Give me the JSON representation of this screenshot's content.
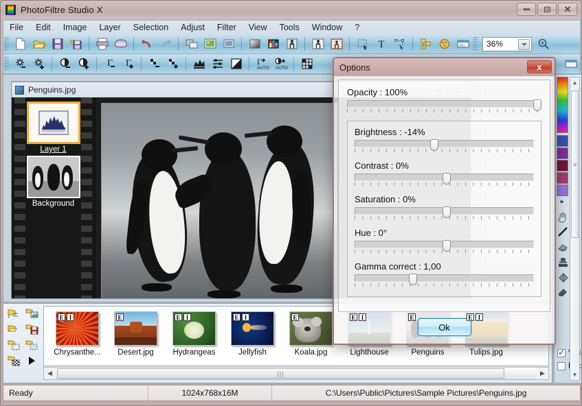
{
  "window": {
    "title": "PhotoFiltre Studio X",
    "icon": "app-logo-icon",
    "controls": {
      "minimize": "minimize",
      "maximize": "maximize",
      "close": "close"
    }
  },
  "menubar": {
    "items": [
      "File",
      "Edit",
      "Image",
      "Layer",
      "Selection",
      "Adjust",
      "Filter",
      "View",
      "Tools",
      "Window",
      "?"
    ]
  },
  "toolbar_main": {
    "zoom_value": "36%",
    "buttons": [
      "new-document-icon",
      "open-folder-icon",
      "save-icon",
      "save-as-icon",
      "print-icon",
      "print-preview-icon",
      "undo-icon",
      "redo-icon",
      "copy-images-icon",
      "paste-image-icon",
      "duplicate-image-icon",
      "gradient-icon",
      "color-palette-icon",
      "transform-icon",
      "effect-icon",
      "framed-effect-icon",
      "selection-icon",
      "text-tool-icon",
      "path-tool-icon",
      "layer-manager-icon",
      "color-wheel-icon",
      "module-icon"
    ],
    "zoom_dropdown": "chevron-down-icon",
    "zoom_in": "magnifier-plus-icon"
  },
  "toolbar_adjust": {
    "buttons": [
      "brightness-decrease-icon",
      "brightness-increase-icon",
      "contrast-decrease-icon",
      "contrast-increase-icon",
      "gamma-decrease-icon",
      "gamma-increase-icon",
      "dither-decrease-icon",
      "dither-increase-icon",
      "histogram-icon",
      "levels-icon",
      "negative-icon",
      "auto-gamma-icon",
      "auto-contrast-icon",
      "grid-icon"
    ],
    "glyphs": [
      "Γ−",
      "Γ+",
      "AUTO"
    ]
  },
  "document": {
    "title": "Penguins.jpg",
    "icon": "image-document-icon",
    "controls": {
      "minimize": "minimize",
      "maximize": "maximize"
    },
    "image_alt": "three-penguins-grayscale-photo"
  },
  "layers": {
    "items": [
      {
        "name": "Layer 1",
        "selected": true,
        "thumb": "histogram-adjustment-layer-icon"
      },
      {
        "name": "Background",
        "selected": false,
        "thumb": "penguins-thumbnail"
      }
    ]
  },
  "layer_props": {
    "visible_label": "Visible",
    "visible_checked": true,
    "locked_label": "Locked",
    "locked_checked": false
  },
  "browser": {
    "tool_buttons": [
      "folder-tree-icon",
      "folder-image-icon",
      "folder-open-icon",
      "folder-save-icon",
      "folder-select-icon",
      "folder-paste-icon",
      "folder-transparent-icon",
      "play-slideshow-icon"
    ],
    "thumbnails": [
      {
        "label": "Chrysanthe...",
        "badges": [
          "E",
          "I"
        ],
        "kind": "flower-red"
      },
      {
        "label": "Desert.jpg",
        "badges": [
          "E"
        ],
        "kind": "desert"
      },
      {
        "label": "Hydrangeas",
        "badges": [
          "E",
          "I"
        ],
        "kind": "hydrangea"
      },
      {
        "label": "Jellyfish",
        "badges": [
          "E",
          "I"
        ],
        "kind": "jellyfish"
      },
      {
        "label": "Koala.jpg",
        "badges": [
          "E"
        ],
        "kind": "koala"
      },
      {
        "label": "Lighthouse",
        "badges": [
          "E",
          "I"
        ],
        "kind": "lighthouse"
      },
      {
        "label": "Penguins",
        "badges": [
          "E"
        ],
        "kind": "penguins"
      },
      {
        "label": "Tulips.jpg",
        "badges": [
          "E",
          "I"
        ],
        "kind": "tulips"
      }
    ],
    "scroll_left": "left-arrow-icon",
    "scroll_right": "right-arrow-icon"
  },
  "right_panel": {
    "palette_icon": "color-spectrum-strip",
    "swatches": [
      "#3b4fa8",
      "#7b2f96",
      "#7a1038",
      "#a23a6e",
      "#9b6fd8"
    ],
    "tools": [
      "hand-tool-icon",
      "line-tool-icon",
      "eraser-tool-icon",
      "stamp-tool-icon",
      "fill-tool-icon",
      "smudge-tool-icon"
    ],
    "scroll_up": "up-arrow-icon",
    "scroll_down": "down-arrow-icon"
  },
  "options_dialog": {
    "title": "Options",
    "close_label": "x",
    "sliders": [
      {
        "name": "opacity",
        "label": "Opacity : 100%",
        "position_pct": 98
      },
      {
        "name": "brightness",
        "label": "Brightness : -14%",
        "position_pct": 43
      },
      {
        "name": "contrast",
        "label": "Contrast : 0%",
        "position_pct": 50
      },
      {
        "name": "saturation",
        "label": "Saturation : 0%",
        "position_pct": 50
      },
      {
        "name": "hue",
        "label": "Hue : 0°",
        "position_pct": 50
      },
      {
        "name": "gamma",
        "label": "Gamma correct : 1,00",
        "position_pct": 31
      }
    ],
    "ok_label": "Ok"
  },
  "statusbar": {
    "state": "Ready",
    "dimensions": "1024x768x16M",
    "path": "C:\\Users\\Public\\Pictures\\Sample Pictures\\Penguins.jpg"
  }
}
